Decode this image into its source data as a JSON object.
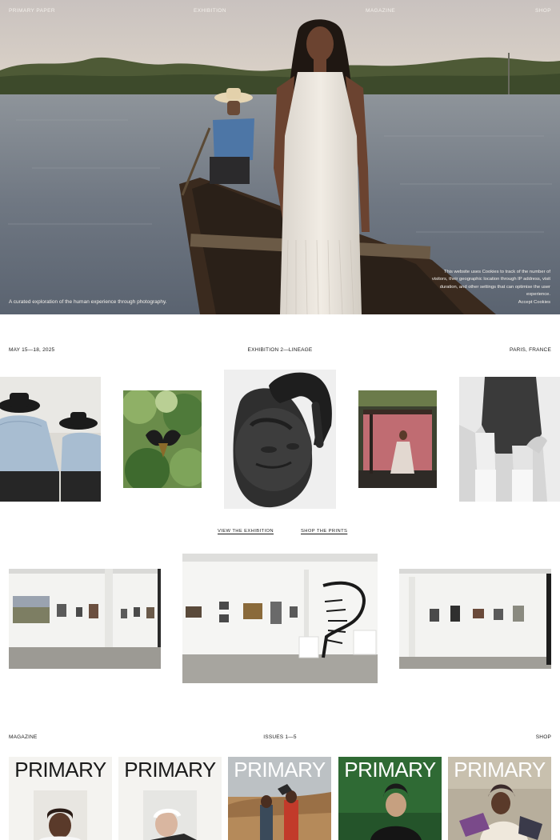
{
  "nav": {
    "brand": "PRIMARY PAPER",
    "exhibition": "EXHIBITION",
    "magazine": "MAGAZINE",
    "shop": "SHOP"
  },
  "hero": {
    "tagline": "A curated exploration of the human experience through photography.",
    "cookie_text": "This website uses Cookies to track of the number of visitors, their geographic location through IP address, visit duration, and other settings that can optimise the user experience.",
    "cookie_accept": "Accept Cookies"
  },
  "exhibition": {
    "date": "MAY 15—18, 2025",
    "title": "EXHIBITION 2—LINEAGE",
    "location": "PARIS, FRANCE",
    "view_link": "VIEW THE EXHIBITION",
    "shop_link": "SHOP THE PRINTS"
  },
  "magazine": {
    "label": "MAGAZINE",
    "issues": "ISSUES 1—5",
    "shop": "SHOP",
    "covers": [
      {
        "title": "PRIMARY",
        "title_color": "#1a1a1a"
      },
      {
        "title": "PRIMARY",
        "title_color": "#1a1a1a"
      },
      {
        "title": "PRIMARY",
        "title_color": "#ffffff"
      },
      {
        "title": "PRIMARY",
        "title_color": "#ffffff"
      },
      {
        "title": "PRIMARY",
        "title_color": "#ffffff"
      }
    ]
  }
}
